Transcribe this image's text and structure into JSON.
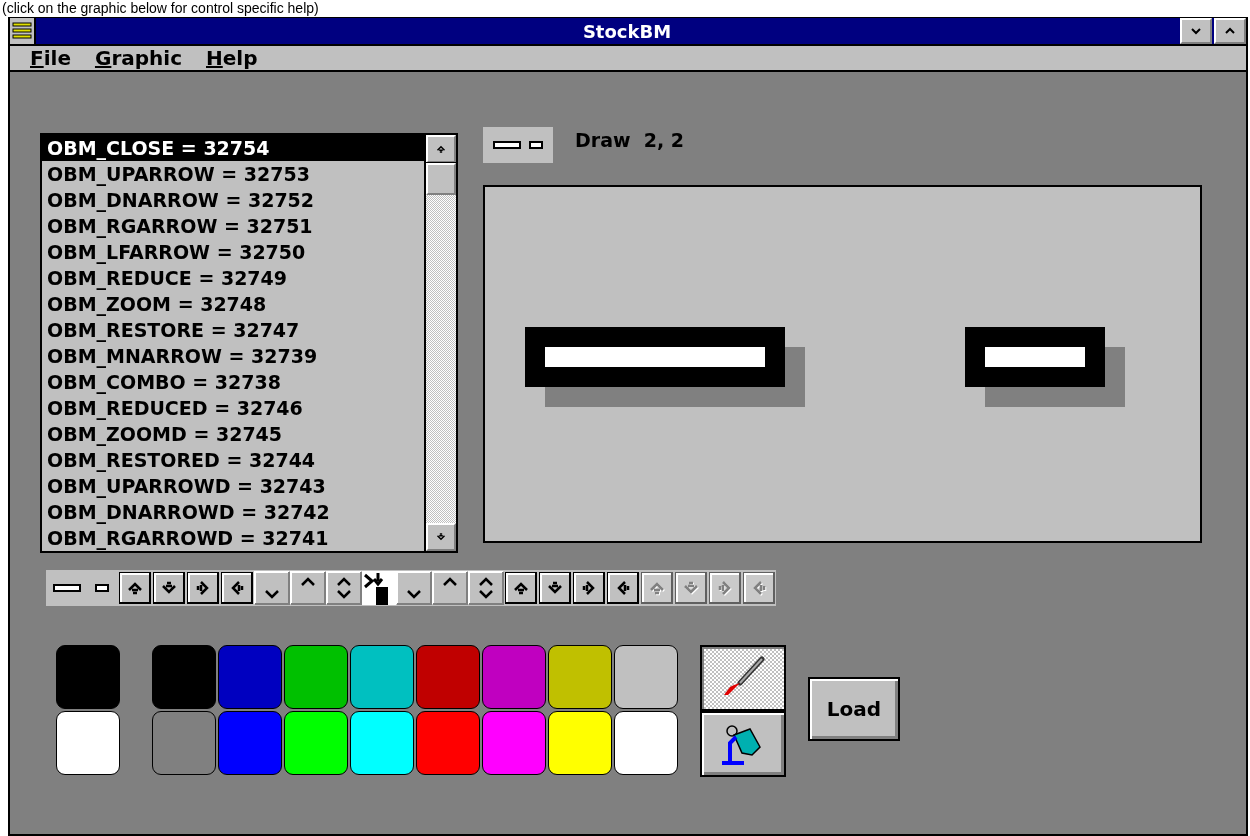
{
  "caption": "(click on the graphic below for control specific help)",
  "window": {
    "title": "StockBM"
  },
  "menu": [
    {
      "label": "File"
    },
    {
      "label": "Graphic"
    },
    {
      "label": "Help"
    }
  ],
  "list": [
    {
      "label": "OBM_CLOSE = 32754",
      "selected": true
    },
    {
      "label": "OBM_UPARROW = 32753",
      "selected": false
    },
    {
      "label": "OBM_DNARROW = 32752",
      "selected": false
    },
    {
      "label": "OBM_RGARROW = 32751",
      "selected": false
    },
    {
      "label": "OBM_LFARROW = 32750",
      "selected": false
    },
    {
      "label": "OBM_REDUCE = 32749",
      "selected": false
    },
    {
      "label": "OBM_ZOOM = 32748",
      "selected": false
    },
    {
      "label": "OBM_RESTORE = 32747",
      "selected": false
    },
    {
      "label": "OBM_MNARROW = 32739",
      "selected": false
    },
    {
      "label": "OBM_COMBO = 32738",
      "selected": false
    },
    {
      "label": "OBM_REDUCED = 32746",
      "selected": false
    },
    {
      "label": "OBM_ZOOMD = 32745",
      "selected": false
    },
    {
      "label": "OBM_RESTORED = 32744",
      "selected": false
    },
    {
      "label": "OBM_UPARROWD = 32743",
      "selected": false
    },
    {
      "label": "OBM_DNARROWD = 32742",
      "selected": false
    },
    {
      "label": "OBM_RGARROWD = 32741",
      "selected": false
    }
  ],
  "status": "Draw  2, 2",
  "bitmaps": [
    {
      "kind": "close",
      "disabled": false
    },
    {
      "kind": "up",
      "disabled": false
    },
    {
      "kind": "down",
      "disabled": false
    },
    {
      "kind": "right",
      "disabled": false
    },
    {
      "kind": "left",
      "disabled": false
    },
    {
      "kind": "reduce",
      "disabled": false
    },
    {
      "kind": "zoom",
      "disabled": false
    },
    {
      "kind": "restore",
      "disabled": false
    },
    {
      "kind": "mnarrow",
      "disabled": false
    },
    {
      "kind": "reduce",
      "disabled": false
    },
    {
      "kind": "zoom",
      "disabled": false
    },
    {
      "kind": "restore",
      "disabled": false
    },
    {
      "kind": "up",
      "disabled": false
    },
    {
      "kind": "down",
      "disabled": false
    },
    {
      "kind": "right",
      "disabled": false
    },
    {
      "kind": "left",
      "disabled": false
    },
    {
      "kind": "up",
      "disabled": true
    },
    {
      "kind": "down",
      "disabled": true
    },
    {
      "kind": "right",
      "disabled": true
    },
    {
      "kind": "left",
      "disabled": true
    }
  ],
  "palette": {
    "current": [
      {
        "color": "#000000"
      },
      {
        "color": "#ffffff"
      }
    ],
    "colors": [
      {
        "color": "#000000"
      },
      {
        "color": "#0000c0"
      },
      {
        "color": "#00c000"
      },
      {
        "color": "#00c0c0"
      },
      {
        "color": "#c00000"
      },
      {
        "color": "#c000c0"
      },
      {
        "color": "#c0c000"
      },
      {
        "color": "#c0c0c0"
      },
      {
        "color": "#808080"
      },
      {
        "color": "#0000ff"
      },
      {
        "color": "#00ff00"
      },
      {
        "color": "#00ffff"
      },
      {
        "color": "#ff0000"
      },
      {
        "color": "#ff00ff"
      },
      {
        "color": "#ffff00"
      },
      {
        "color": "#ffffff"
      }
    ]
  },
  "tools": [
    {
      "kind": "brush",
      "selected": true
    },
    {
      "kind": "bucket",
      "selected": false
    }
  ],
  "load_button": "Load"
}
